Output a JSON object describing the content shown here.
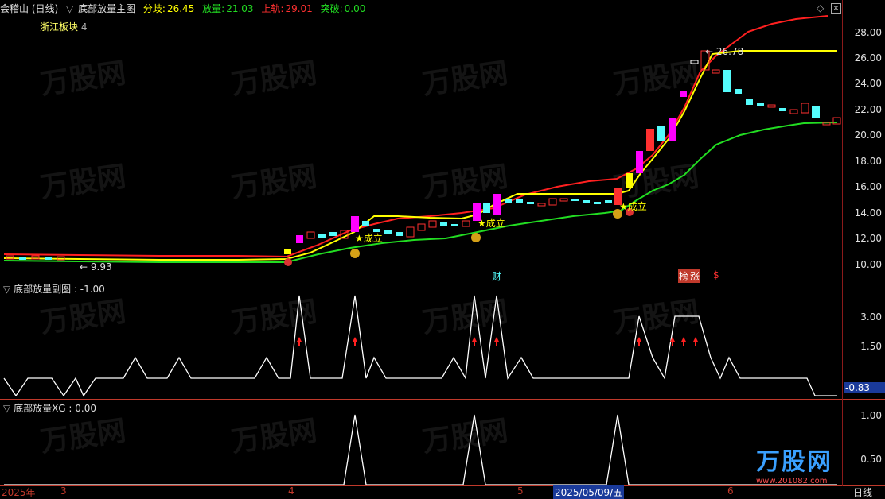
{
  "header": {
    "stock": "会稽山 (日线)",
    "indicator": "底部放量主图",
    "fenqi_label": "分歧:",
    "fenqi_value": "26.45",
    "fangliang_label": "放量:",
    "fangliang_value": "21.03",
    "shanggui_label": "上轨:",
    "shanggui_value": "29.01",
    "tupo_label": "突破:",
    "tupo_value": "0.00",
    "sector": "浙江板块",
    "sector_count": "4"
  },
  "main_axis": [
    "28.00",
    "26.00",
    "24.00",
    "22.00",
    "20.00",
    "18.00",
    "16.00",
    "14.00",
    "12.00",
    "10.00"
  ],
  "annotations": {
    "low": "← 9.93",
    "high": "← 26.78",
    "signal": "★成立",
    "cai": "财",
    "bang": "榜",
    "zhang": "涨",
    "dollar": "$"
  },
  "sub1": {
    "title": "底部放量副图 : -1.00",
    "axis": [
      "3.00",
      "1.50"
    ],
    "current": "-0.83"
  },
  "sub2": {
    "title": "底部放量XG : 0.00",
    "axis": [
      "1.00",
      "0.50"
    ]
  },
  "xaxis": {
    "y2025": "2025年",
    "m3": "3",
    "m4": "4",
    "m5": "5",
    "date": "2025/05/09/五",
    "m6": "6",
    "period": "日线"
  },
  "logo": {
    "brand": "万股网",
    "url": "www.201082.com"
  },
  "colors": {
    "up": "#ff3030",
    "down": "#54fcfc",
    "magenta": "#ff00ff",
    "yellow": "#ffff00",
    "red_line": "#ff2020",
    "green_line": "#22dd22",
    "white": "#ffffff"
  }
}
